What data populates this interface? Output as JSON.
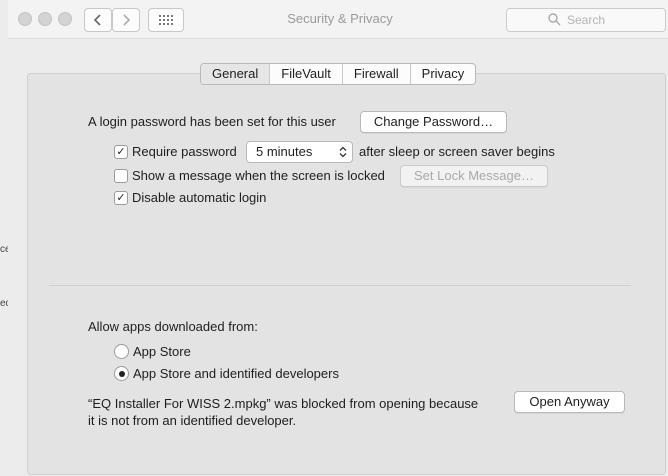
{
  "window": {
    "title": "Security & Privacy",
    "search_placeholder": "Search"
  },
  "background": {
    "text_fragments": [
      "ce",
      "ec"
    ]
  },
  "tabs": [
    {
      "label": "General",
      "active": true
    },
    {
      "label": "FileVault",
      "active": false
    },
    {
      "label": "Firewall",
      "active": false
    },
    {
      "label": "Privacy",
      "active": false
    }
  ],
  "general": {
    "login_text": "A login password has been set for this user",
    "change_password_button": "Change Password…",
    "require_password": {
      "label": "Require password",
      "checked": true,
      "delay_value": "5 minutes",
      "suffix": "after sleep or screen saver begins"
    },
    "show_message": {
      "label": "Show a message when the screen is locked",
      "checked": false,
      "button": "Set Lock Message…"
    },
    "disable_autologin": {
      "label": "Disable automatic login",
      "checked": true
    },
    "allow_apps": {
      "heading": "Allow apps downloaded from:",
      "options": [
        {
          "label": "App Store",
          "selected": false
        },
        {
          "label": "App Store and identified developers",
          "selected": true
        }
      ]
    },
    "blocked_message": {
      "line1": "“EQ Installer For WISS 2.mpkg” was blocked from opening because",
      "line2": "it is not from an identified developer.",
      "button": "Open Anyway"
    }
  }
}
